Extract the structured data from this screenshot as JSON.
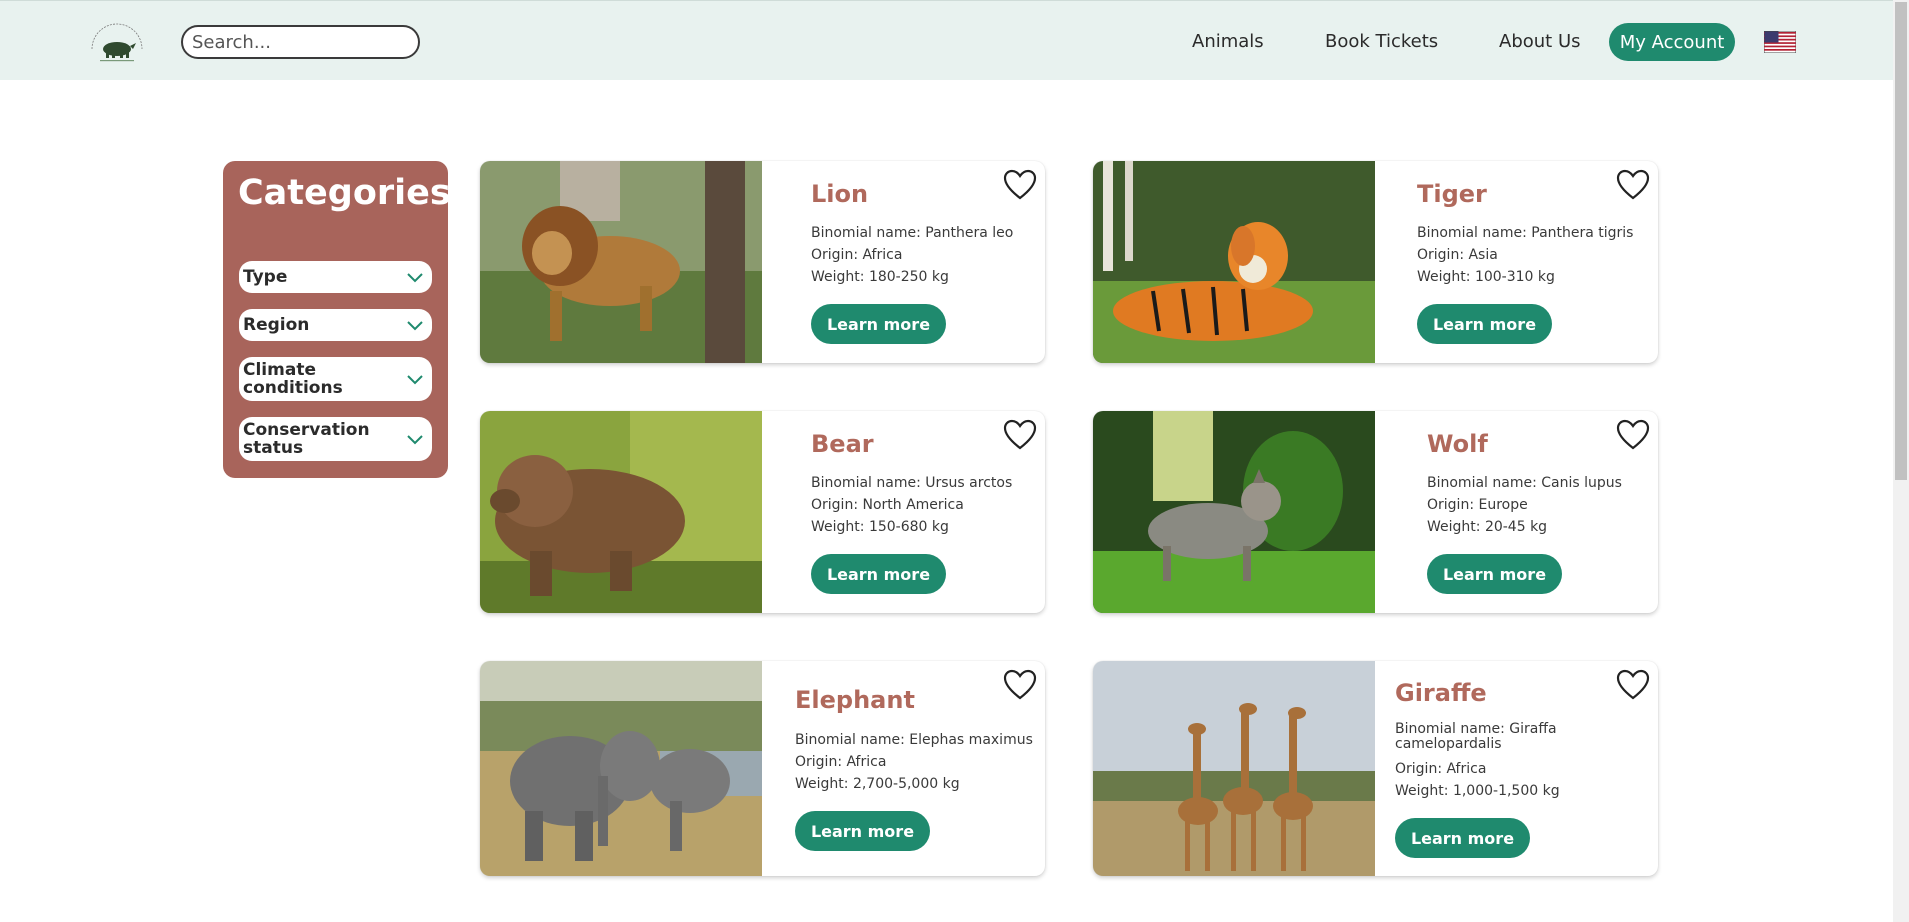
{
  "header": {
    "search_placeholder": "Search...",
    "nav": {
      "animals": "Animals",
      "book_tickets": "Book Tickets",
      "about_us": "About Us",
      "my_account": "My Account"
    },
    "flag_icon": "us-flag-icon",
    "logo_icon": "wild-wonders-zoo-logo"
  },
  "categories": {
    "title": "Categories",
    "filters": [
      "Type",
      "Region",
      "Climate conditions",
      "Conservation status"
    ]
  },
  "animals": [
    {
      "name": "Lion",
      "binomial": "Binomial name: Panthera leo",
      "origin": "Origin: Africa",
      "weight": "Weight: 180-250 kg",
      "button": "Learn more"
    },
    {
      "name": "Tiger",
      "binomial": "Binomial name: Panthera tigris",
      "origin": "Origin: Asia",
      "weight": "Weight: 100-310 kg",
      "button": "Learn more"
    },
    {
      "name": "Bear",
      "binomial": "Binomial name: Ursus arctos",
      "origin": "Origin: North America",
      "weight": "Weight: 150-680 kg",
      "button": "Learn more"
    },
    {
      "name": "Wolf",
      "binomial": "Binomial name: Canis lupus",
      "origin": "Origin: Europe",
      "weight": "Weight: 20-45 kg",
      "button": "Learn more"
    },
    {
      "name": "Elephant",
      "binomial": "Binomial name: Elephas maximus",
      "origin": "Origin: Africa",
      "weight": "Weight: 2,700-5,000 kg",
      "button": "Learn more"
    },
    {
      "name": "Giraffe",
      "binomial": "Binomial name: Giraffa camelopardalis",
      "origin": "Origin: Africa",
      "weight": "Weight: 1,000-1,500 kg",
      "button": "Learn more"
    }
  ],
  "colors": {
    "accent": "#1f8a6e",
    "brand": "#a8645b",
    "title": "#b0695c",
    "header_bg": "#e8f2ef"
  }
}
